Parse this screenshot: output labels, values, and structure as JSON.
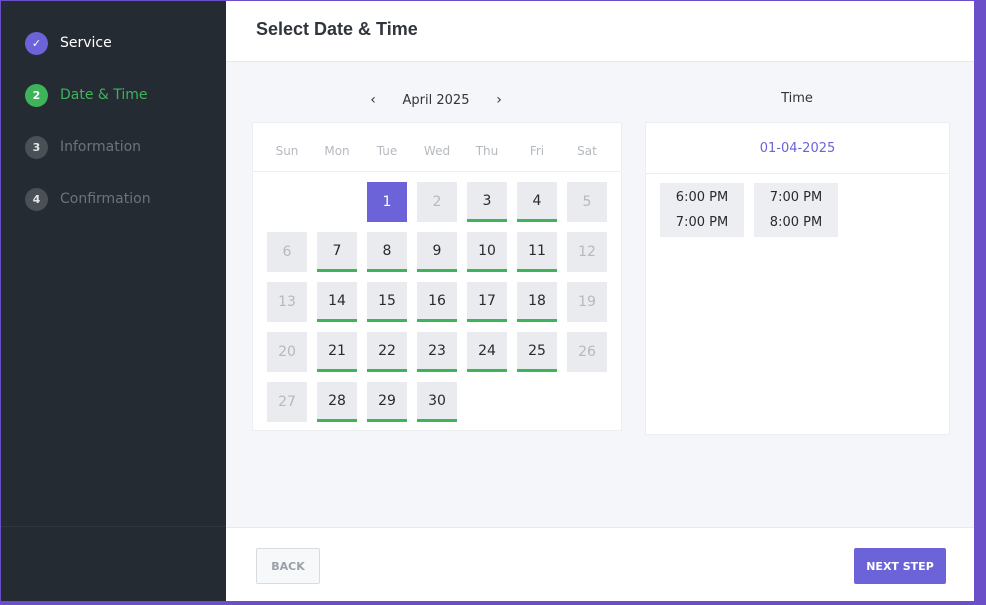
{
  "sidebar": {
    "steps": [
      {
        "number": "✓",
        "label": "Service",
        "state": "done"
      },
      {
        "number": "2",
        "label": "Date & Time",
        "state": "active"
      },
      {
        "number": "3",
        "label": "Information",
        "state": "todo"
      },
      {
        "number": "4",
        "label": "Confirmation",
        "state": "todo"
      }
    ]
  },
  "header": {
    "title": "Select Date & Time"
  },
  "calendar": {
    "prev": "‹",
    "next": "›",
    "month": "April 2025",
    "weekdays": [
      "Sun",
      "Mon",
      "Tue",
      "Wed",
      "Thu",
      "Fri",
      "Sat"
    ],
    "days": [
      {
        "d": "1",
        "state": "selected"
      },
      {
        "d": "2",
        "state": "disabled"
      },
      {
        "d": "3",
        "state": "available"
      },
      {
        "d": "4",
        "state": "available"
      },
      {
        "d": "5",
        "state": "disabled"
      },
      {
        "d": "6",
        "state": "disabled"
      },
      {
        "d": "7",
        "state": "available"
      },
      {
        "d": "8",
        "state": "available"
      },
      {
        "d": "9",
        "state": "available"
      },
      {
        "d": "10",
        "state": "available"
      },
      {
        "d": "11",
        "state": "available"
      },
      {
        "d": "12",
        "state": "disabled"
      },
      {
        "d": "13",
        "state": "disabled"
      },
      {
        "d": "14",
        "state": "available"
      },
      {
        "d": "15",
        "state": "available"
      },
      {
        "d": "16",
        "state": "available"
      },
      {
        "d": "17",
        "state": "available"
      },
      {
        "d": "18",
        "state": "available"
      },
      {
        "d": "19",
        "state": "disabled"
      },
      {
        "d": "20",
        "state": "disabled"
      },
      {
        "d": "21",
        "state": "available"
      },
      {
        "d": "22",
        "state": "available"
      },
      {
        "d": "23",
        "state": "available"
      },
      {
        "d": "24",
        "state": "available"
      },
      {
        "d": "25",
        "state": "available"
      },
      {
        "d": "26",
        "state": "disabled"
      },
      {
        "d": "27",
        "state": "disabled"
      },
      {
        "d": "28",
        "state": "available"
      },
      {
        "d": "29",
        "state": "available"
      },
      {
        "d": "30",
        "state": "available"
      }
    ]
  },
  "time": {
    "title": "Time",
    "date": "01-04-2025",
    "slots": [
      {
        "start": "6:00 PM",
        "end": "7:00 PM"
      },
      {
        "start": "7:00 PM",
        "end": "8:00 PM"
      }
    ]
  },
  "footer": {
    "back": "BACK",
    "next": "NEXT STEP"
  },
  "colors": {
    "accent": "#6c63d9",
    "success": "#3db45a",
    "sidebar": "#252b33"
  }
}
